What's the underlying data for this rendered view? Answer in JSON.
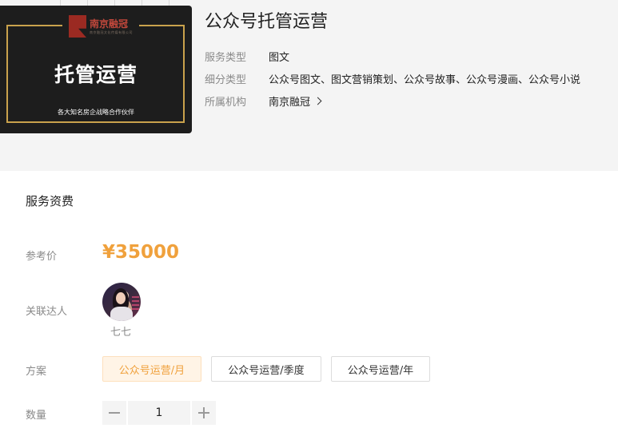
{
  "cover": {
    "logo_name": "南京融冠",
    "logo_sub": "南京融冠文化传媒有限公司",
    "headline": "托管运营",
    "slogan": "各大知名房企战略合作伙伴",
    "brand_color": "#c9a24c"
  },
  "product": {
    "title": "公众号托管运营",
    "meta": [
      {
        "key": "服务类型",
        "value": "图文"
      },
      {
        "key": "细分类型",
        "value": "公众号图文、图文营销策划、公众号故事、公众号漫画、公众号小说"
      },
      {
        "key": "所属机构",
        "value": "南京融冠"
      }
    ]
  },
  "fees": {
    "section_title": "服务资费",
    "price_label": "参考价",
    "price": "¥35000",
    "price_color": "#f0a13c",
    "talent_label": "关联达人",
    "talent_name": "七七",
    "plan_label": "方案",
    "plans": [
      "公众号运营/月",
      "公众号运营/季度",
      "公众号运营/年"
    ],
    "selected_plan": "公众号运营/月",
    "quantity_label": "数量",
    "quantity": "1"
  },
  "icons": {
    "institution_arrow": "chevron-right-icon",
    "decrement": "minus-icon",
    "increment": "plus-icon"
  }
}
